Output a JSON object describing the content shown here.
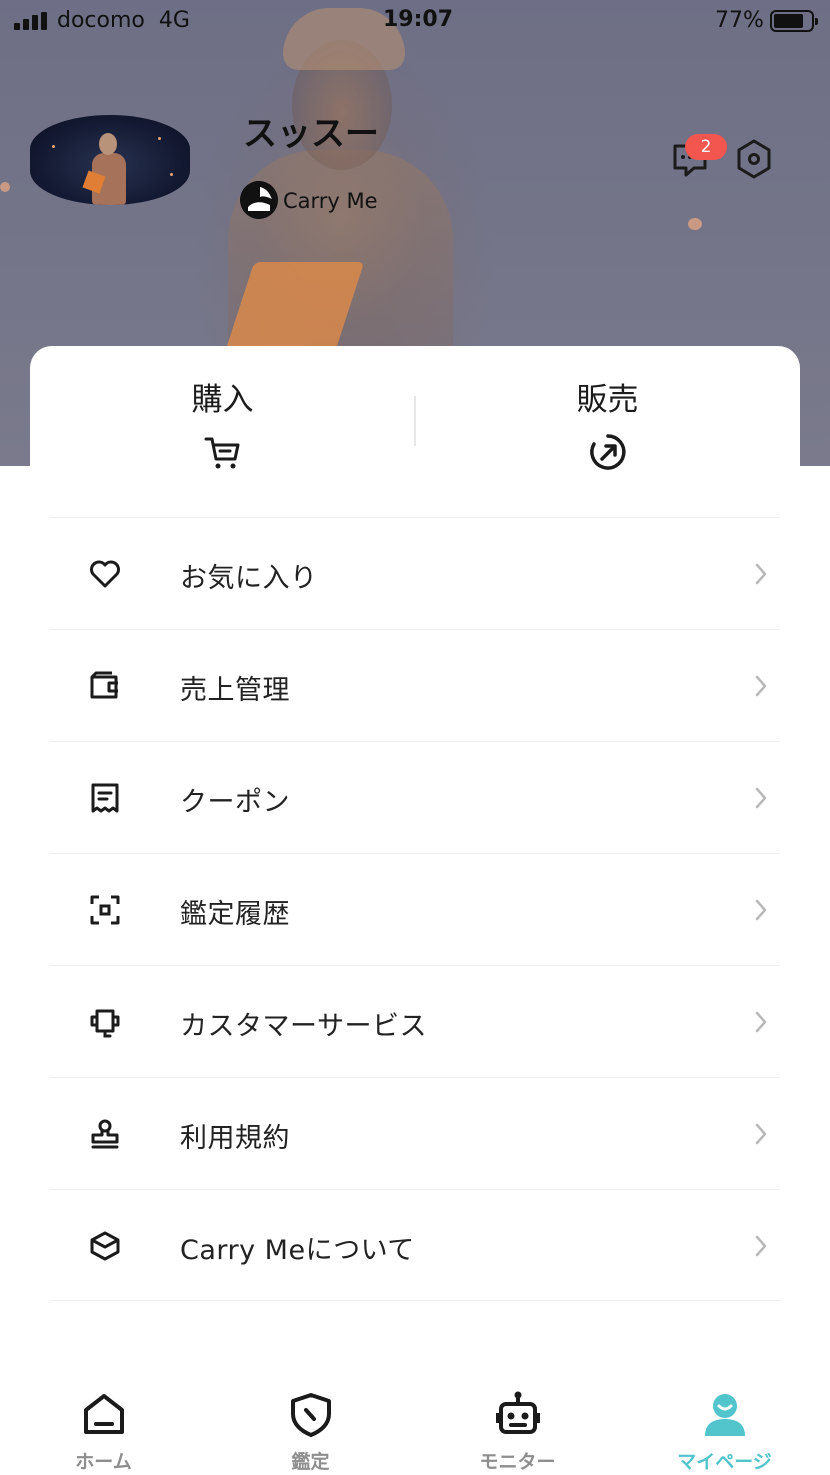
{
  "status_bar": {
    "carrier": "docomo",
    "network": "4G",
    "time": "19:07",
    "battery": "77%",
    "battery_level": 0.77
  },
  "profile": {
    "username": "スッスー",
    "app_name": "Carry Me",
    "avatar_icon": "avatar-performer-image"
  },
  "header_icons": {
    "message_icon": "chat-bubble-icon",
    "message_badge": "2",
    "settings_icon": "hexagon-settings-icon"
  },
  "trade": {
    "buy_label": "購入",
    "buy_icon": "cart-icon",
    "sell_label": "販売",
    "sell_icon": "sell-arrow-icon"
  },
  "menu": {
    "items": [
      {
        "label": "お気に入り",
        "icon": "heart-icon"
      },
      {
        "label": "売上管理",
        "icon": "wallet-icon"
      },
      {
        "label": "クーポン",
        "icon": "receipt-icon"
      },
      {
        "label": "鑑定履歴",
        "icon": "scan-icon"
      },
      {
        "label": "カスタマーサービス",
        "icon": "headset-icon"
      },
      {
        "label": "利用規約",
        "icon": "stamp-icon"
      },
      {
        "label": "Carry Meについて",
        "icon": "box-icon"
      }
    ]
  },
  "bottom_nav": {
    "items": [
      {
        "label": "ホーム",
        "icon": "home-icon"
      },
      {
        "label": "鑑定",
        "icon": "shield-icon"
      },
      {
        "label": "モニター",
        "icon": "robot-icon"
      },
      {
        "label": "マイページ",
        "icon": "user-icon"
      }
    ],
    "active_color": "#52c4cc",
    "inactive_color": "#8e8e8e"
  }
}
